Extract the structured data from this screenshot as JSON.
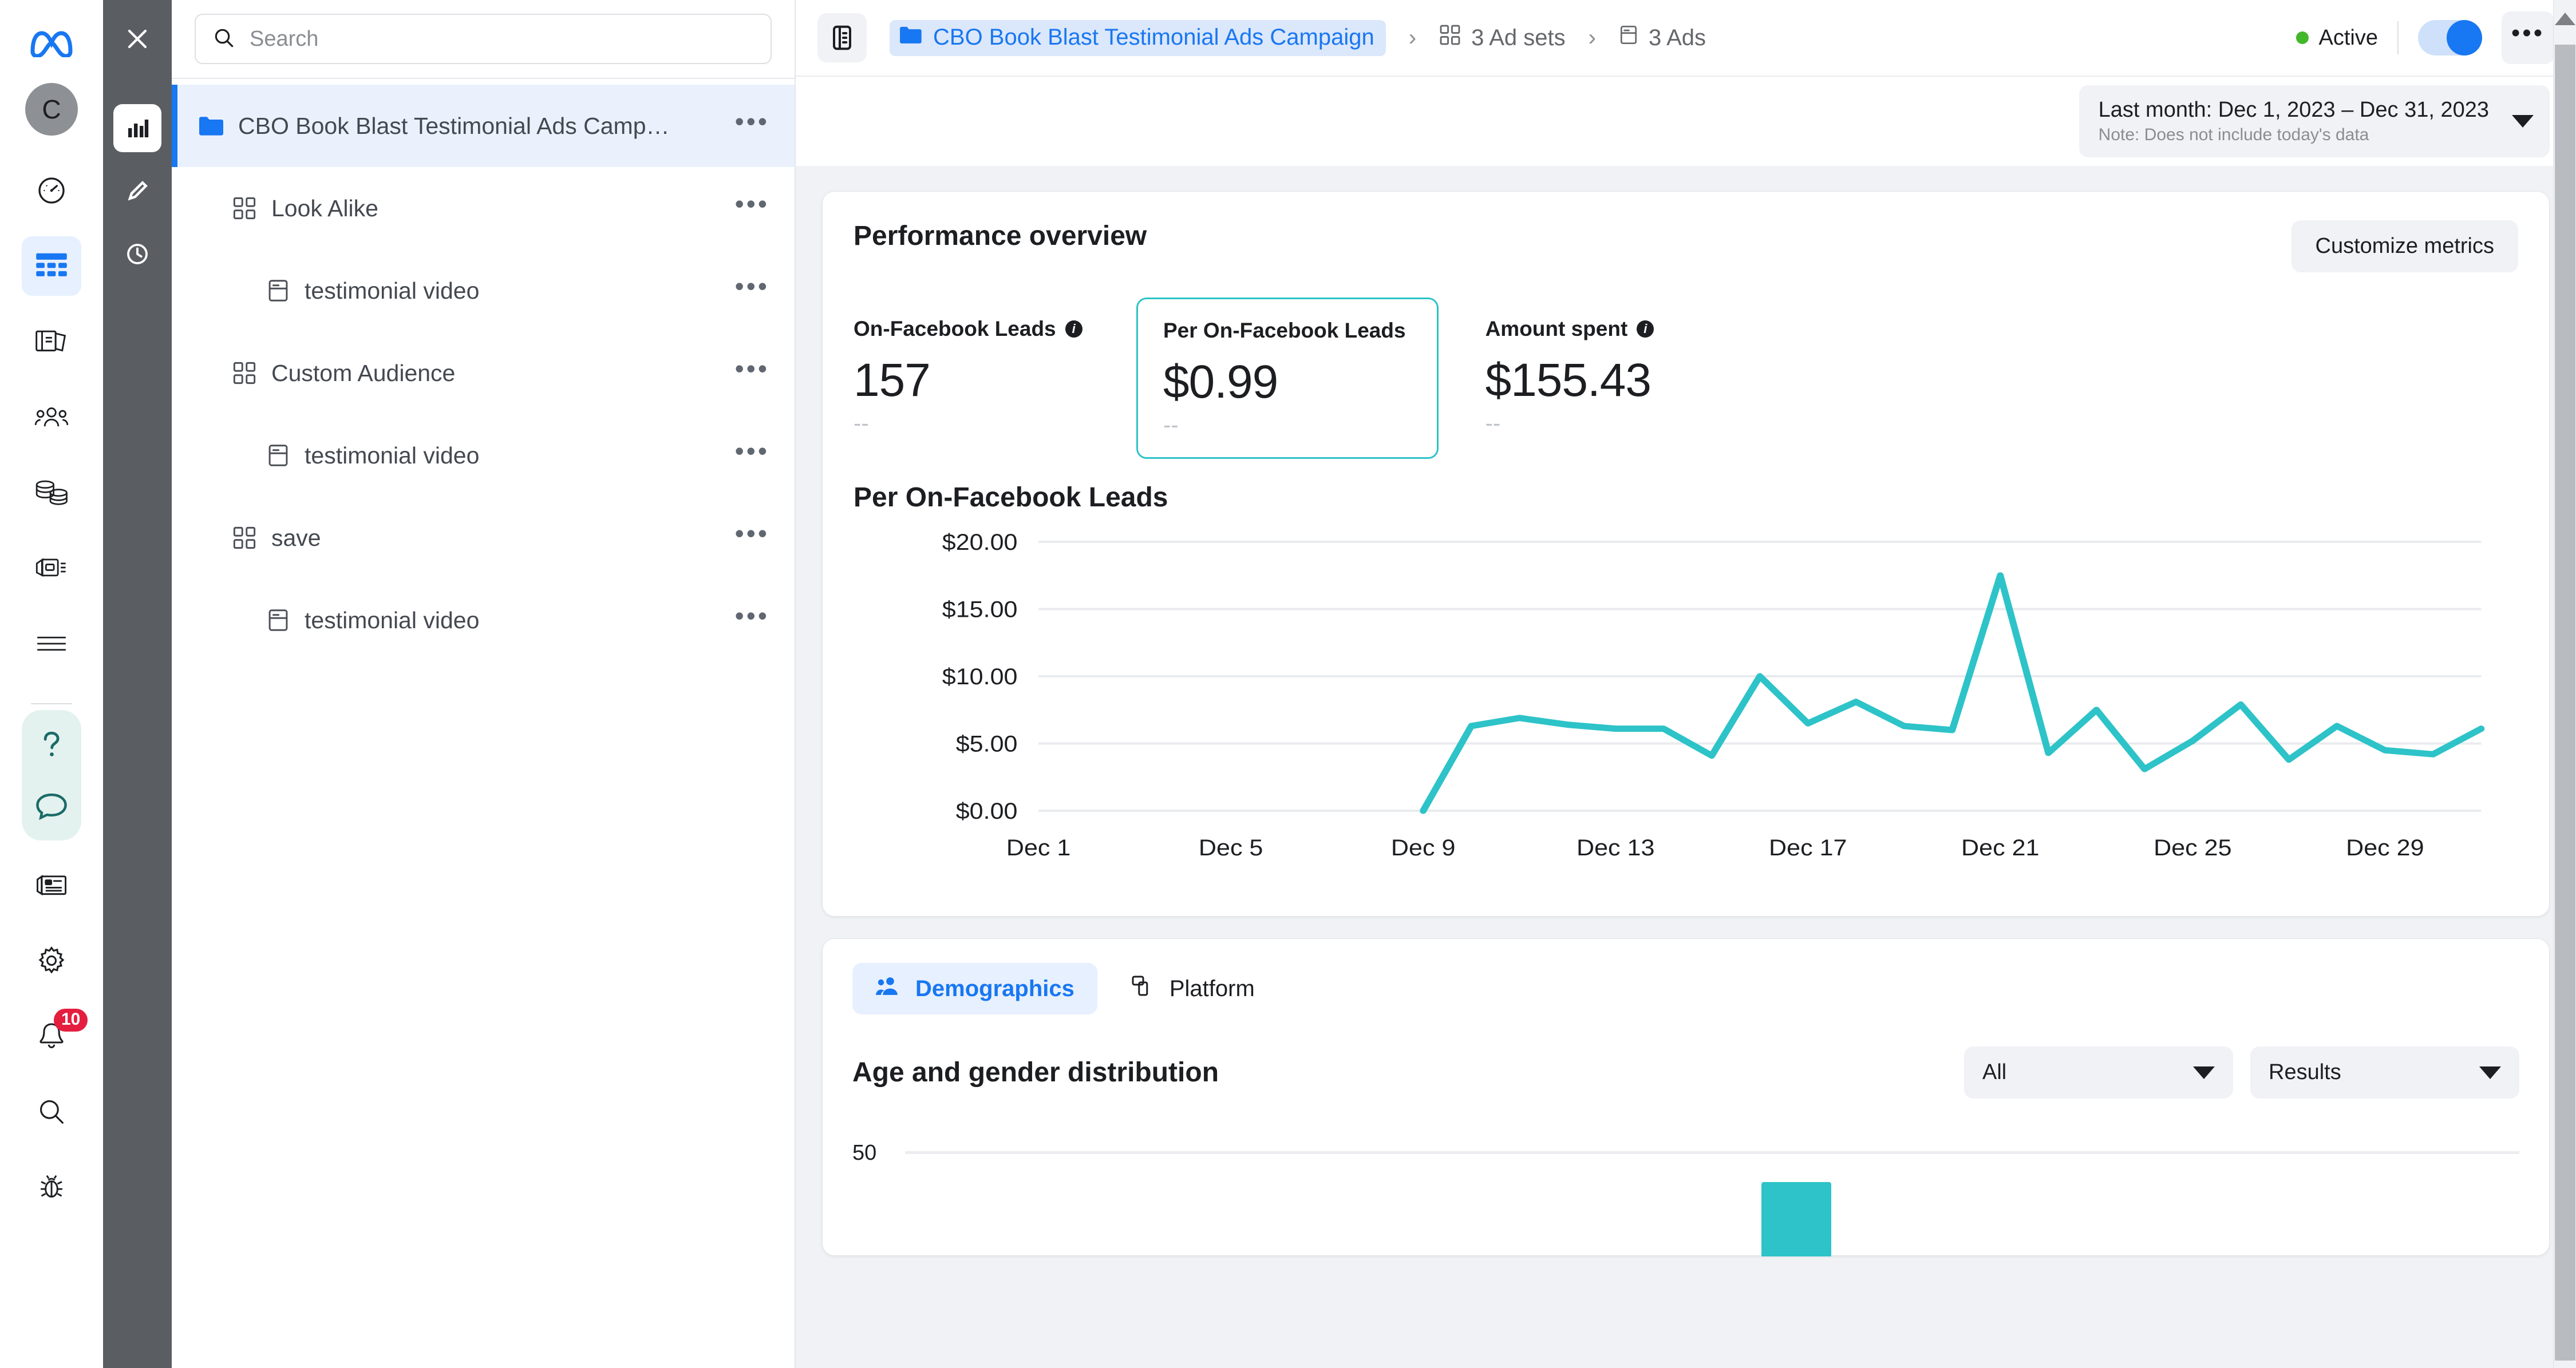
{
  "rail": {
    "logo_icon": "meta-logo-icon",
    "avatar_initial": "C",
    "items": [
      {
        "name": "dashboard-gauge-icon",
        "label": "Dashboard"
      },
      {
        "name": "table-grid-icon",
        "label": "Campaigns",
        "active": true
      },
      {
        "name": "pages-icon",
        "label": "Pages"
      },
      {
        "name": "audiences-icon",
        "label": "Audiences"
      },
      {
        "name": "billing-coins-icon",
        "label": "Billing"
      },
      {
        "name": "ads-library-icon",
        "label": "Ad library"
      },
      {
        "name": "list-lines-icon",
        "label": "All tools"
      }
    ],
    "bottom_items": [
      {
        "name": "help-question-icon",
        "label": "Help"
      },
      {
        "name": "feedback-bubble-icon",
        "label": "Feedback"
      },
      {
        "name": "news-icon",
        "label": "News"
      },
      {
        "name": "gear-icon",
        "label": "Settings"
      },
      {
        "name": "bell-icon",
        "label": "Notifications",
        "badge": "10"
      },
      {
        "name": "search-icon",
        "label": "Search"
      },
      {
        "name": "bug-icon",
        "label": "Report bug"
      }
    ]
  },
  "strip": {
    "close_icon": "close-icon",
    "buttons": [
      {
        "name": "chart-bars-icon",
        "label": "Performance",
        "selected": true
      },
      {
        "name": "pencil-edit-icon",
        "label": "Edit"
      },
      {
        "name": "clock-history-icon",
        "label": "History"
      }
    ]
  },
  "sidebar": {
    "search": {
      "placeholder": "Search",
      "value": ""
    },
    "tree": [
      {
        "level": 0,
        "icon": "folder-icon",
        "label": "CBO Book Blast Testimonial Ads Camp…",
        "selected": true,
        "menu": "•••"
      },
      {
        "level": 1,
        "icon": "adset-grid-icon",
        "label": "Look Alike",
        "selected": false,
        "menu": "•••"
      },
      {
        "level": 2,
        "icon": "ad-card-icon",
        "label": "testimonial video",
        "selected": false,
        "menu": "•••"
      },
      {
        "level": 1,
        "icon": "adset-grid-icon",
        "label": "Custom Audience",
        "selected": false,
        "menu": "•••"
      },
      {
        "level": 2,
        "icon": "ad-card-icon",
        "label": "testimonial video",
        "selected": false,
        "menu": "•••"
      },
      {
        "level": 1,
        "icon": "adset-grid-icon",
        "label": "save",
        "selected": false,
        "menu": "•••"
      },
      {
        "level": 2,
        "icon": "ad-card-icon",
        "label": "testimonial video",
        "selected": false,
        "menu": "•••"
      }
    ]
  },
  "topbar": {
    "panel_toggle_icon": "panel-toggle-icon",
    "breadcrumb": [
      {
        "icon": "folder-icon",
        "label": "CBO Book Blast Testimonial Ads Campaign",
        "active": true
      },
      {
        "icon": "adset-grid-icon",
        "label": "3 Ad sets",
        "active": false
      },
      {
        "icon": "ad-card-icon",
        "label": "3 Ads",
        "active": false
      }
    ],
    "separator": "›",
    "status": "Active",
    "status_color": "#42b72a",
    "toggle_on": true,
    "more_label": "•••"
  },
  "daterange": {
    "label": "Last month: Dec 1, 2023 – Dec 31, 2023",
    "note": "Note: Does not include today's data"
  },
  "performance": {
    "title": "Performance overview",
    "customize_label": "Customize metrics",
    "metrics": [
      {
        "label": "On-Facebook Leads",
        "has_info": true,
        "value": "157",
        "sub": "--",
        "highlighted": false
      },
      {
        "label": "Per On-Facebook Leads",
        "has_info": false,
        "value": "$0.99",
        "sub": "--",
        "highlighted": true
      },
      {
        "label": "Amount spent",
        "has_info": true,
        "value": "$155.43",
        "sub": "--",
        "highlighted": false
      }
    ]
  },
  "chart_data": {
    "type": "line",
    "title": "Per On-Facebook Leads",
    "xlabel": "",
    "ylabel": "",
    "ylim": [
      0,
      20
    ],
    "yticks": [
      "$0.00",
      "$5.00",
      "$10.00",
      "$15.00",
      "$20.00"
    ],
    "ytick_values": [
      0,
      5,
      10,
      15,
      20
    ],
    "grid": true,
    "legend": "none",
    "line_color": "#2dc3c8",
    "xtick_labels": [
      "Dec 1",
      "Dec 5",
      "Dec 9",
      "Dec 13",
      "Dec 17",
      "Dec 21",
      "Dec 25",
      "Dec 29"
    ],
    "xtick_days": [
      1,
      5,
      9,
      13,
      17,
      21,
      25,
      29
    ],
    "x": [
      "Dec 9",
      "Dec 10",
      "Dec 11",
      "Dec 12",
      "Dec 13",
      "Dec 14",
      "Dec 15",
      "Dec 16",
      "Dec 17",
      "Dec 18",
      "Dec 19",
      "Dec 20",
      "Dec 21",
      "Dec 22",
      "Dec 23",
      "Dec 24",
      "Dec 25",
      "Dec 26",
      "Dec 27",
      "Dec 28",
      "Dec 29",
      "Dec 30",
      "Dec 31"
    ],
    "values": [
      0.0,
      6.3,
      6.9,
      6.4,
      6.1,
      6.1,
      4.1,
      10.0,
      6.5,
      8.1,
      6.3,
      6.0,
      17.5,
      4.3,
      7.5,
      3.1,
      5.2,
      7.9,
      3.8,
      6.3,
      4.5,
      4.2,
      6.1
    ],
    "note": "Series begins at $0.00 on Dec 9; no data plotted Dec 1 – Dec 8"
  },
  "tabs": [
    {
      "icon": "people-icon",
      "label": "Demographics",
      "active": true
    },
    {
      "icon": "platform-icon",
      "label": "Platform",
      "active": false
    }
  ],
  "demographics": {
    "title": "Age and gender distribution",
    "filter_all": "All",
    "filter_metric": "Results",
    "ytick": "50",
    "bar_color": "#2dc3c8"
  },
  "colors": {
    "accent_blue": "#1877f2",
    "teal": "#2dc3c8",
    "green": "#42b72a",
    "badge_red": "#e41e3f"
  }
}
